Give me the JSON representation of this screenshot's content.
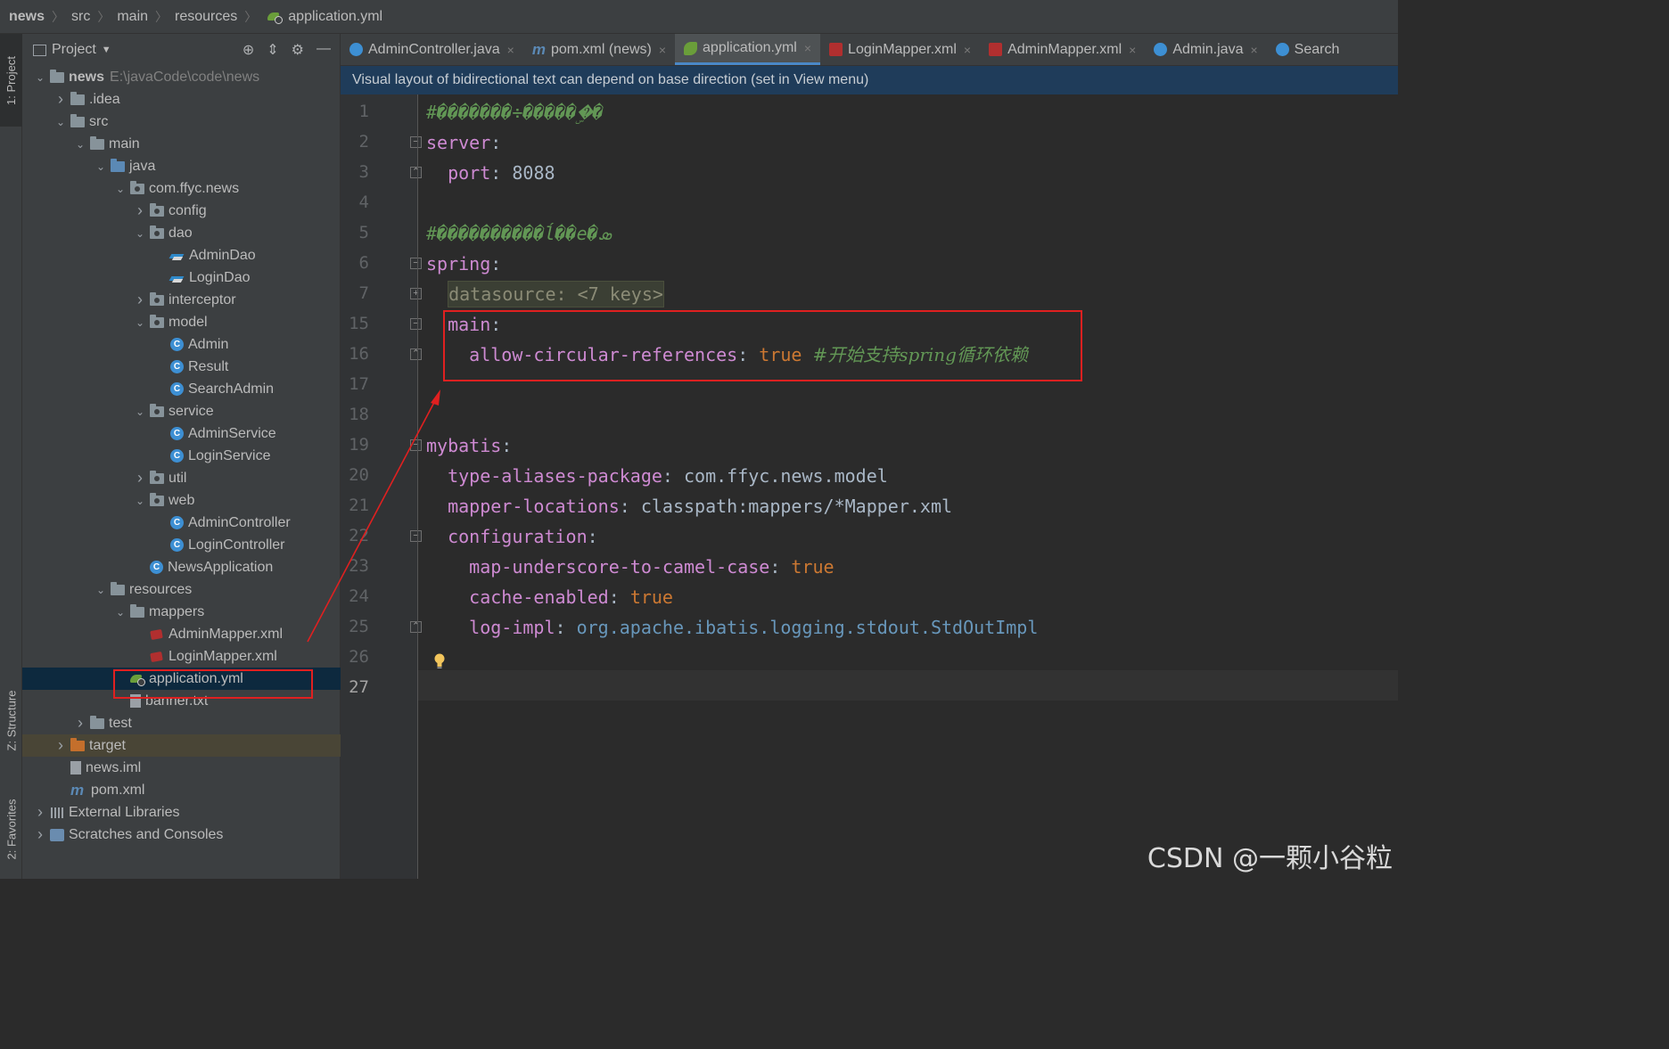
{
  "breadcrumb": [
    "news",
    "src",
    "main",
    "resources",
    "application.yml"
  ],
  "tool_strip": {
    "project": "1: Project",
    "structure": "Z: Structure",
    "favorites": "2: Favorites"
  },
  "project_panel": {
    "title": "Project"
  },
  "tree": [
    {
      "label": "news",
      "extra": "E:\\javaCode\\code\\news",
      "icon": "folder",
      "chev": "v"
    },
    {
      "label": ".idea",
      "icon": "folder",
      "chev": ">"
    },
    {
      "label": "src",
      "icon": "folder",
      "chev": "v"
    },
    {
      "label": "main",
      "icon": "folder",
      "chev": "v"
    },
    {
      "label": "java",
      "icon": "folder-blue",
      "chev": "v"
    },
    {
      "label": "com.ffyc.news",
      "icon": "package",
      "chev": "v"
    },
    {
      "label": "config",
      "icon": "package",
      "chev": ">"
    },
    {
      "label": "dao",
      "icon": "package",
      "chev": "v"
    },
    {
      "label": "AdminDao",
      "icon": "mapper",
      "chev": ""
    },
    {
      "label": "LoginDao",
      "icon": "mapper",
      "chev": ""
    },
    {
      "label": "interceptor",
      "icon": "package",
      "chev": ">"
    },
    {
      "label": "model",
      "icon": "package",
      "chev": "v"
    },
    {
      "label": "Admin",
      "icon": "class",
      "chev": ""
    },
    {
      "label": "Result",
      "icon": "class",
      "chev": ""
    },
    {
      "label": "SearchAdmin",
      "icon": "class",
      "chev": ""
    },
    {
      "label": "service",
      "icon": "package",
      "chev": "v"
    },
    {
      "label": "AdminService",
      "icon": "class",
      "chev": ""
    },
    {
      "label": "LoginService",
      "icon": "class",
      "chev": ""
    },
    {
      "label": "util",
      "icon": "package",
      "chev": ">"
    },
    {
      "label": "web",
      "icon": "package",
      "chev": "v"
    },
    {
      "label": "AdminController",
      "icon": "class",
      "chev": ""
    },
    {
      "label": "LoginController",
      "icon": "class",
      "chev": ""
    },
    {
      "label": "NewsApplication",
      "icon": "class",
      "chev": ""
    },
    {
      "label": "resources",
      "icon": "folder",
      "chev": "v"
    },
    {
      "label": "mappers",
      "icon": "folder",
      "chev": "v"
    },
    {
      "label": "AdminMapper.xml",
      "icon": "xml",
      "chev": ""
    },
    {
      "label": "LoginMapper.xml",
      "icon": "xml",
      "chev": ""
    },
    {
      "label": "application.yml",
      "icon": "yml",
      "chev": ""
    },
    {
      "label": "banner.txt",
      "icon": "txt",
      "chev": ""
    },
    {
      "label": "test",
      "icon": "folder",
      "chev": ">"
    },
    {
      "label": "target",
      "icon": "folder-orange",
      "chev": ">"
    },
    {
      "label": "news.iml",
      "icon": "iml",
      "chev": ""
    },
    {
      "label": "pom.xml",
      "icon": "pom",
      "chev": ""
    },
    {
      "label": "External Libraries",
      "icon": "libs",
      "chev": ">"
    },
    {
      "label": "Scratches and Consoles",
      "icon": "scratch",
      "chev": ">"
    }
  ],
  "tabs": [
    {
      "label": "AdminController.java",
      "icon": "class"
    },
    {
      "label": "pom.xml (news)",
      "icon": "m"
    },
    {
      "label": "application.yml",
      "icon": "yml",
      "active": true
    },
    {
      "label": "LoginMapper.xml",
      "icon": "xml"
    },
    {
      "label": "AdminMapper.xml",
      "icon": "xml"
    },
    {
      "label": "Admin.java",
      "icon": "class"
    },
    {
      "label": "Search",
      "icon": "class"
    }
  ],
  "notice": "Visual layout of bidirectional text can depend on base direction (set in View menu)",
  "line_numbers": [
    "1",
    "2",
    "3",
    "4",
    "5",
    "6",
    "7",
    "15",
    "16",
    "17",
    "18",
    "19",
    "20",
    "21",
    "22",
    "23",
    "24",
    "25",
    "26",
    "27"
  ],
  "code": {
    "l1": "#�������÷������ۣ�",
    "l2_key": "server",
    "l3_key": "port",
    "l3_val": "8088",
    "l5": "#����������ĺ��e�ܣ",
    "l6_key": "spring",
    "l7_fold": "datasource: <7 keys>",
    "l15_key": "main",
    "l16_key": "allow-circular-references",
    "l16_val": "true",
    "l16_cmt": "#开始支持spring循环依赖",
    "l19_key": "mybatis",
    "l20_key": "type-aliases-package",
    "l20_val": "com.ffyc.news.model",
    "l21_key": "mapper-locations",
    "l21_val": "classpath:mappers/*Mapper.xml",
    "l22_key": "configuration",
    "l23_key": "map-underscore-to-camel-case",
    "l23_val": "true",
    "l24_key": "cache-enabled",
    "l24_val": "true",
    "l25_key": "log-impl",
    "l25_val": "org.apache.ibatis.logging.stdout.StdOutImpl"
  },
  "watermark": "CSDN @一颗小谷粒"
}
